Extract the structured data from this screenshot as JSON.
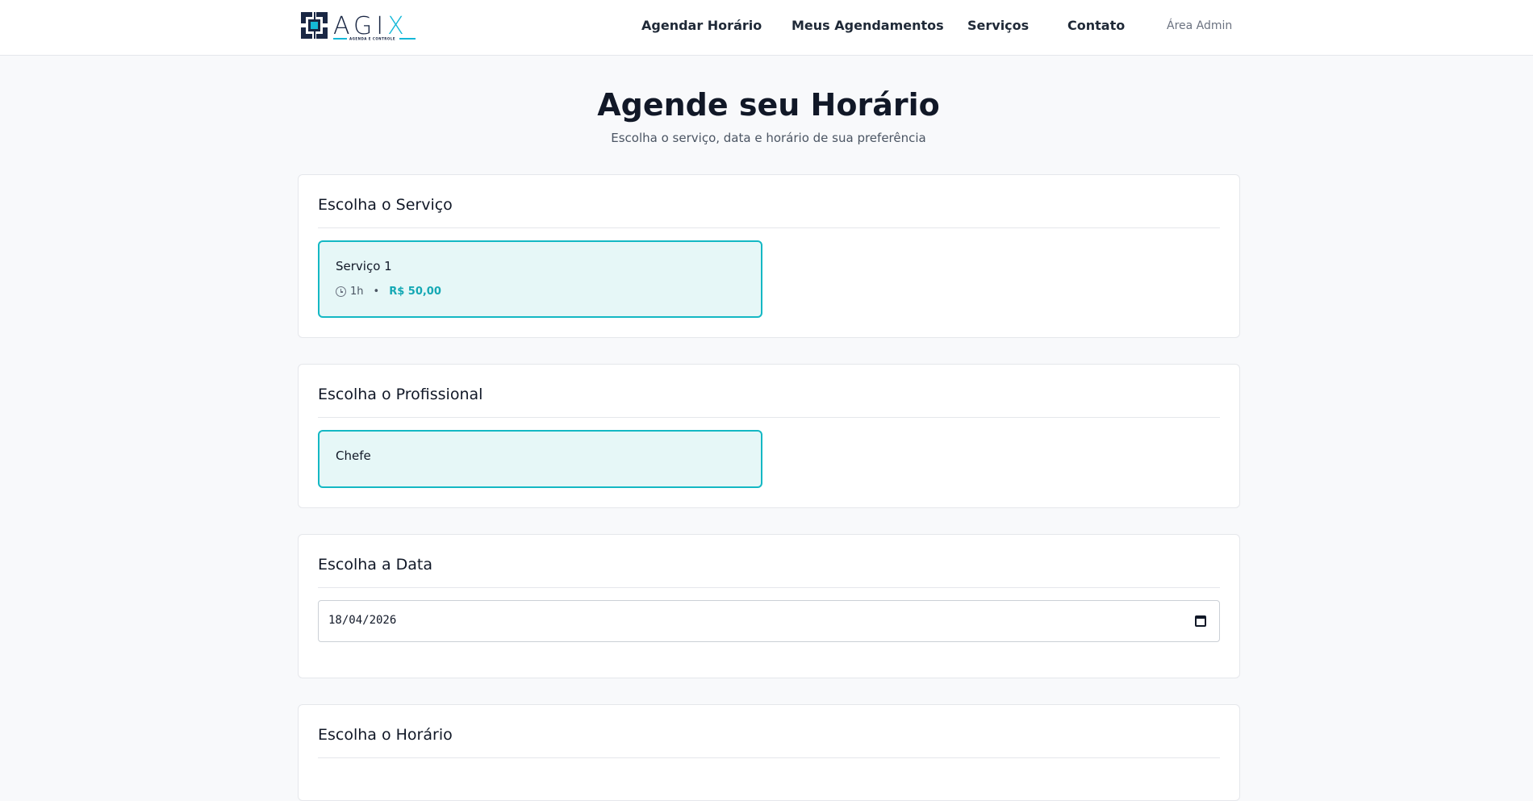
{
  "brand": {
    "name": "AGIX",
    "tagline": "AGENDA E CONTROLE",
    "colors": {
      "dark": "#1a2744",
      "accent": "#14b8d8"
    }
  },
  "nav": {
    "items": [
      {
        "label": "Agendar Horário"
      },
      {
        "label": "Meus Agendamentos"
      },
      {
        "label": "Serviços"
      },
      {
        "label": "Contato"
      }
    ],
    "admin_label": "Área Admin"
  },
  "hero": {
    "title": "Agende seu Horário",
    "subtitle": "Escolha o serviço, data e horário de sua preferência"
  },
  "service_section": {
    "title": "Escolha o Serviço",
    "selected": {
      "name": "Serviço 1",
      "duration": "1h",
      "separator": "•",
      "price": "R$ 50,00",
      "icon": "clock-icon"
    }
  },
  "professional_section": {
    "title": "Escolha o Profissional",
    "selected": {
      "name": "Chefe"
    }
  },
  "date_section": {
    "title": "Escolha a Data",
    "value": "18/04/2026",
    "icon": "calendar-icon"
  },
  "time_section": {
    "title": "Escolha o Horário"
  },
  "colors": {
    "selected_border": "#14b8c4",
    "selected_background": "#e6f7f7",
    "price": "#14a8b4"
  }
}
